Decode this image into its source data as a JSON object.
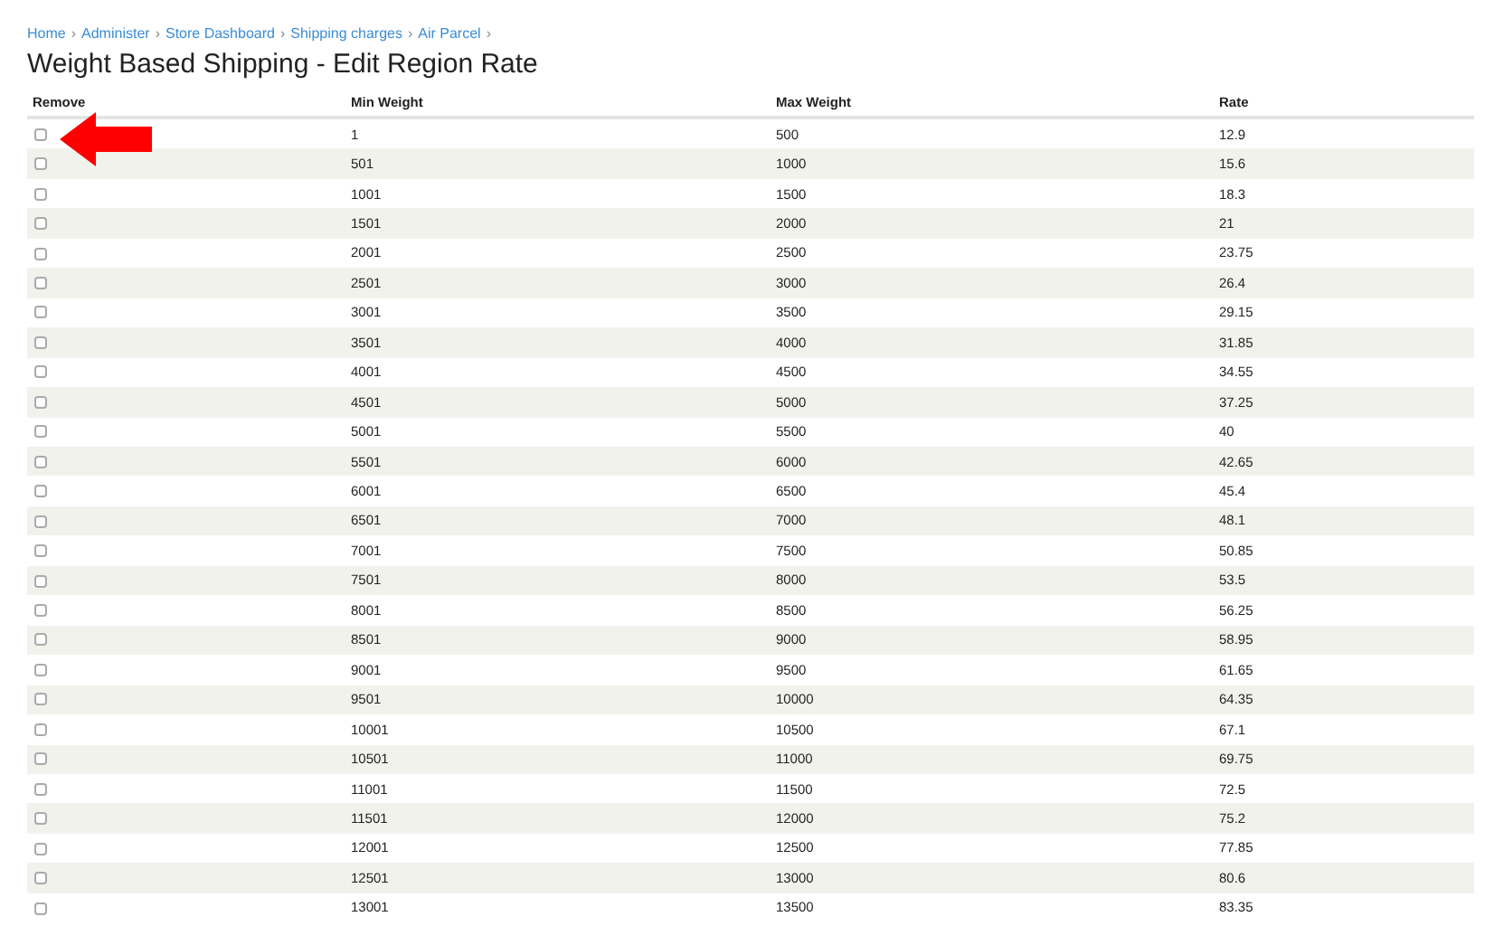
{
  "breadcrumb": {
    "separator": "›",
    "items": [
      "Home",
      "Administer",
      "Store Dashboard",
      "Shipping charges",
      "Air Parcel"
    ]
  },
  "title": "Weight Based Shipping - Edit Region Rate",
  "table": {
    "columns": [
      "Remove",
      "Min Weight",
      "Max Weight",
      "Rate"
    ],
    "rows": [
      {
        "checked": false,
        "min": "1",
        "max": "500",
        "rate": "12.9"
      },
      {
        "checked": false,
        "min": "501",
        "max": "1000",
        "rate": "15.6"
      },
      {
        "checked": false,
        "min": "1001",
        "max": "1500",
        "rate": "18.3"
      },
      {
        "checked": false,
        "min": "1501",
        "max": "2000",
        "rate": "21"
      },
      {
        "checked": false,
        "min": "2001",
        "max": "2500",
        "rate": "23.75"
      },
      {
        "checked": false,
        "min": "2501",
        "max": "3000",
        "rate": "26.4"
      },
      {
        "checked": false,
        "min": "3001",
        "max": "3500",
        "rate": "29.15"
      },
      {
        "checked": false,
        "min": "3501",
        "max": "4000",
        "rate": "31.85"
      },
      {
        "checked": false,
        "min": "4001",
        "max": "4500",
        "rate": "34.55"
      },
      {
        "checked": false,
        "min": "4501",
        "max": "5000",
        "rate": "37.25"
      },
      {
        "checked": false,
        "min": "5001",
        "max": "5500",
        "rate": "40"
      },
      {
        "checked": false,
        "min": "5501",
        "max": "6000",
        "rate": "42.65"
      },
      {
        "checked": false,
        "min": "6001",
        "max": "6500",
        "rate": "45.4"
      },
      {
        "checked": false,
        "min": "6501",
        "max": "7000",
        "rate": "48.1"
      },
      {
        "checked": false,
        "min": "7001",
        "max": "7500",
        "rate": "50.85"
      },
      {
        "checked": false,
        "min": "7501",
        "max": "8000",
        "rate": "53.5"
      },
      {
        "checked": false,
        "min": "8001",
        "max": "8500",
        "rate": "56.25"
      },
      {
        "checked": false,
        "min": "8501",
        "max": "9000",
        "rate": "58.95"
      },
      {
        "checked": false,
        "min": "9001",
        "max": "9500",
        "rate": "61.65"
      },
      {
        "checked": false,
        "min": "9501",
        "max": "10000",
        "rate": "64.35"
      },
      {
        "checked": false,
        "min": "10001",
        "max": "10500",
        "rate": "67.1"
      },
      {
        "checked": false,
        "min": "10501",
        "max": "11000",
        "rate": "69.75"
      },
      {
        "checked": false,
        "min": "11001",
        "max": "11500",
        "rate": "72.5"
      },
      {
        "checked": false,
        "min": "11501",
        "max": "12000",
        "rate": "75.2"
      },
      {
        "checked": false,
        "min": "12001",
        "max": "12500",
        "rate": "77.85"
      },
      {
        "checked": false,
        "min": "12501",
        "max": "13000",
        "rate": "80.6"
      },
      {
        "checked": false,
        "min": "13001",
        "max": "13500",
        "rate": "83.35"
      }
    ]
  }
}
